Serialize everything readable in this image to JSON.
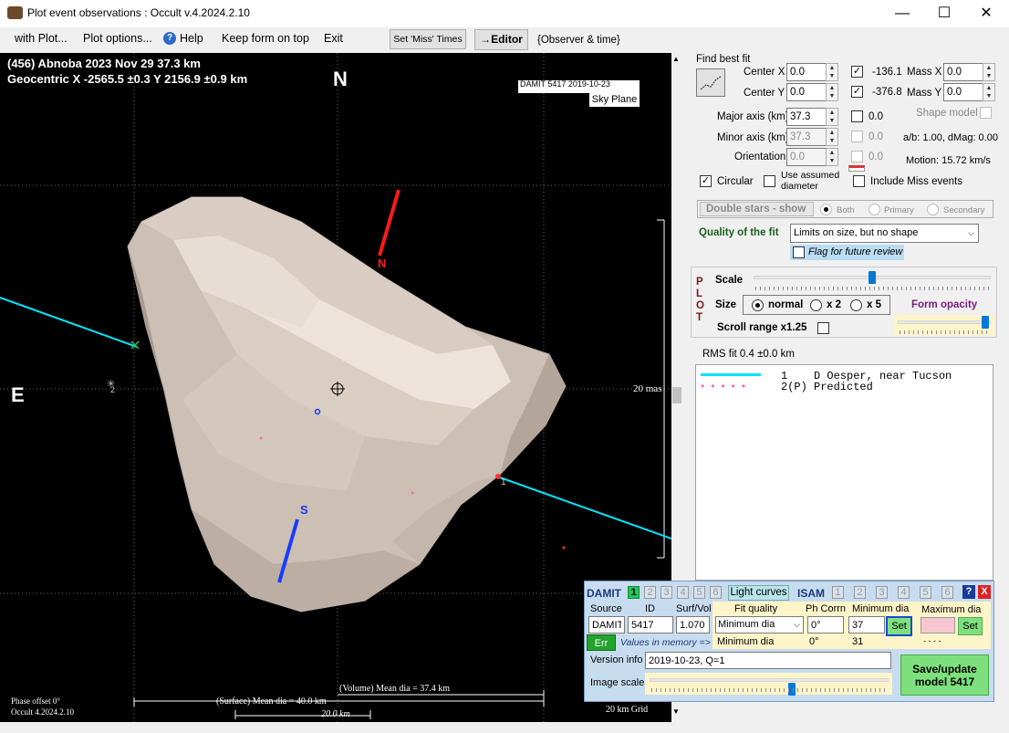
{
  "window": {
    "title": "Plot event observations : Occult v.4.2024.2.10",
    "minimize": "—",
    "maximize": "☐",
    "close": "✕"
  },
  "menu": {
    "with_plot": "with Plot...",
    "plot_options": "Plot options...",
    "help": "Help",
    "keep_on_top": "Keep form on top",
    "exit": "Exit",
    "set_miss_times": "Set 'Miss' Times",
    "editor": "→Editor",
    "observer_time": "{Observer & time}"
  },
  "plot": {
    "header_line1": "(456) Abnoba  2023 Nov 29  37.3 km",
    "header_line2": "Geocentric  X  -2565.5 ±0.3  Y 2156.9 ±0.9 km",
    "north": "N",
    "east": "E",
    "sky_plane": "Sky Plane",
    "damit_label": "DAMIT 5417 2019-10-23",
    "axis_n": "N",
    "axis_s": "S",
    "scale_20mas": "20 mas",
    "chord1": "1",
    "chord2": "2",
    "phase_offset": "Phase offset 0°",
    "occult_version": "Occult 4.2024.2.10",
    "volume_dia": "(Volume) Mean dia = 37.4 km",
    "surface_dia": "(Surface) Mean dia = 40.0 km",
    "km_scale": "20.0  km",
    "grid": "20 km Grid"
  },
  "fit": {
    "group_label": "Find best fit",
    "center_x_label": "Center X",
    "center_x": "0.0",
    "center_y_label": "Center Y",
    "center_y": "0.0",
    "major_label": "Major axis (km)",
    "major": "37.3",
    "minor_label": "Minor axis (km)",
    "minor": "37.3",
    "orient_label": "Orientation",
    "orient": "0.0",
    "cx_check_val": "-136.1",
    "cy_check_val": "-376.8",
    "major_check_val": "0.0",
    "minor_check_val": "0.0",
    "orient_check_val": "0.0",
    "mass_x_label": "Mass X",
    "mass_x": "0.0",
    "mass_y_label": "Mass Y",
    "mass_y": "0.0",
    "shape_model": "Shape model",
    "ab_dmag": "a/b: 1.00, dMag: 0.00",
    "motion": "Motion: 15.72 km/s",
    "circular": "Circular",
    "use_assumed": "Use assumed diameter",
    "include_miss": "Include Miss events",
    "double_stars": "Double stars - show",
    "both": "Both",
    "primary": "Primary",
    "secondary": "Secondary",
    "quality_label": "Quality of the fit",
    "quality_value": "Limits on size, but no shape",
    "flag_review": "Flag for future review"
  },
  "plotbox": {
    "vertical": "PLOT",
    "scale": "Scale",
    "size": "Size",
    "normal": "normal",
    "x2": "x 2",
    "x5": "x 5",
    "form_opacity": "Form opacity",
    "scroll_range": "Scroll range x1.25",
    "scale_level": 0.5,
    "opacity_level": 0.98
  },
  "legend": {
    "rms": "RMS fit 0.4 ±0.0 km",
    "row1": "1    D Oesper, near Tucson",
    "row2": "2(P) Predicted",
    "line_color": "#00e5ff",
    "predicted_color": "#ff69b4"
  },
  "damit": {
    "title": "DAMIT",
    "tabs": [
      "1",
      "2",
      "3",
      "4",
      "5",
      "6"
    ],
    "light_curves": "Light curves",
    "isam": "ISAM",
    "help": "?",
    "close": "X",
    "source_label": "Source",
    "source": "DAMIT",
    "id_label": "ID",
    "id": "5417",
    "surf_vol_label": "Surf/Vol",
    "surf_vol": "1.070",
    "fit_quality_label": "Fit quality",
    "fit_quality": "Minimum dia",
    "ph_corrn_label": "Ph Corrn",
    "ph_corrn": "0°",
    "min_dia_label": "Minimum dia",
    "min_dia": "37",
    "max_dia_label": "Maximum dia",
    "set": "Set",
    "err": "Err",
    "values_memory": "Values in memory =>",
    "mem_fit": "Minimum dia",
    "mem_ph": "0°",
    "mem_min": "31",
    "mem_max": "- - - -",
    "version_label": "Version info",
    "version": "2019-10-23, Q=1",
    "image_scale": "Image scale",
    "image_scale_level": 0.6,
    "save": "Save/update model 5417"
  }
}
